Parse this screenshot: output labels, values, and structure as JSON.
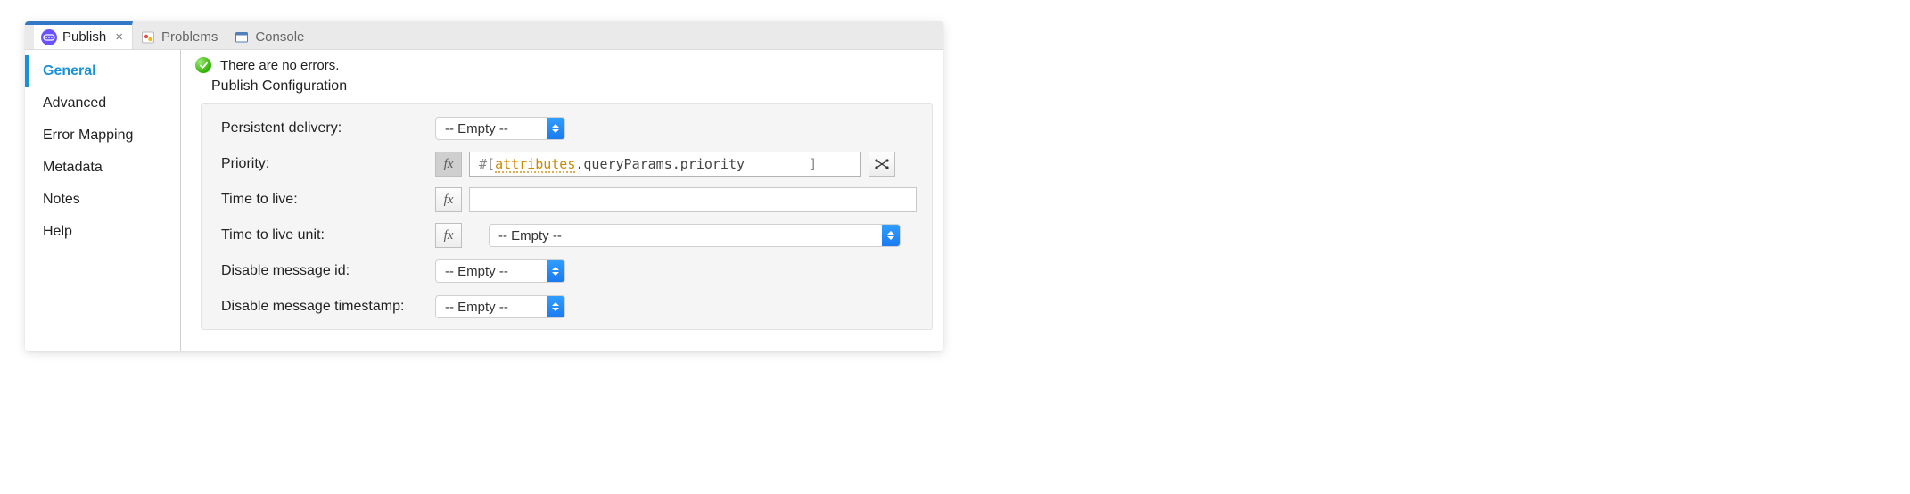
{
  "tabs": [
    {
      "id": "publish",
      "label": "Publish",
      "active": true,
      "closeable": true
    },
    {
      "id": "problems",
      "label": "Problems",
      "active": false
    },
    {
      "id": "console",
      "label": "Console",
      "active": false
    }
  ],
  "sidebar": {
    "items": [
      {
        "id": "general",
        "label": "General",
        "active": true
      },
      {
        "id": "advanced",
        "label": "Advanced",
        "active": false
      },
      {
        "id": "error-mapping",
        "label": "Error Mapping",
        "active": false
      },
      {
        "id": "metadata",
        "label": "Metadata",
        "active": false
      },
      {
        "id": "notes",
        "label": "Notes",
        "active": false
      },
      {
        "id": "help",
        "label": "Help",
        "active": false
      }
    ]
  },
  "main": {
    "status_message": "There are no errors.",
    "section_title": "Publish Configuration",
    "fields": {
      "persistent_delivery": {
        "label": "Persistent delivery:",
        "value": "-- Empty --"
      },
      "priority": {
        "label": "Priority:",
        "fx_active": true,
        "expression": "#[ attributes.queryParams.priority        ]",
        "expression_tokens": {
          "open": "#[ ",
          "attr": "attributes",
          "dot1": ".",
          "qp": "queryParams",
          "dot2": ".",
          "prio": "priority",
          "pad": "        ",
          "close": "]"
        }
      },
      "ttl": {
        "label": "Time to live:",
        "value": ""
      },
      "ttl_unit": {
        "label": "Time to live unit:",
        "value": "-- Empty --"
      },
      "disable_message_id": {
        "label": "Disable message id:",
        "value": "-- Empty --"
      },
      "disable_message_timestamp": {
        "label": "Disable message timestamp:",
        "value": "-- Empty --"
      }
    }
  },
  "icons": {
    "fx_label": "fx"
  }
}
